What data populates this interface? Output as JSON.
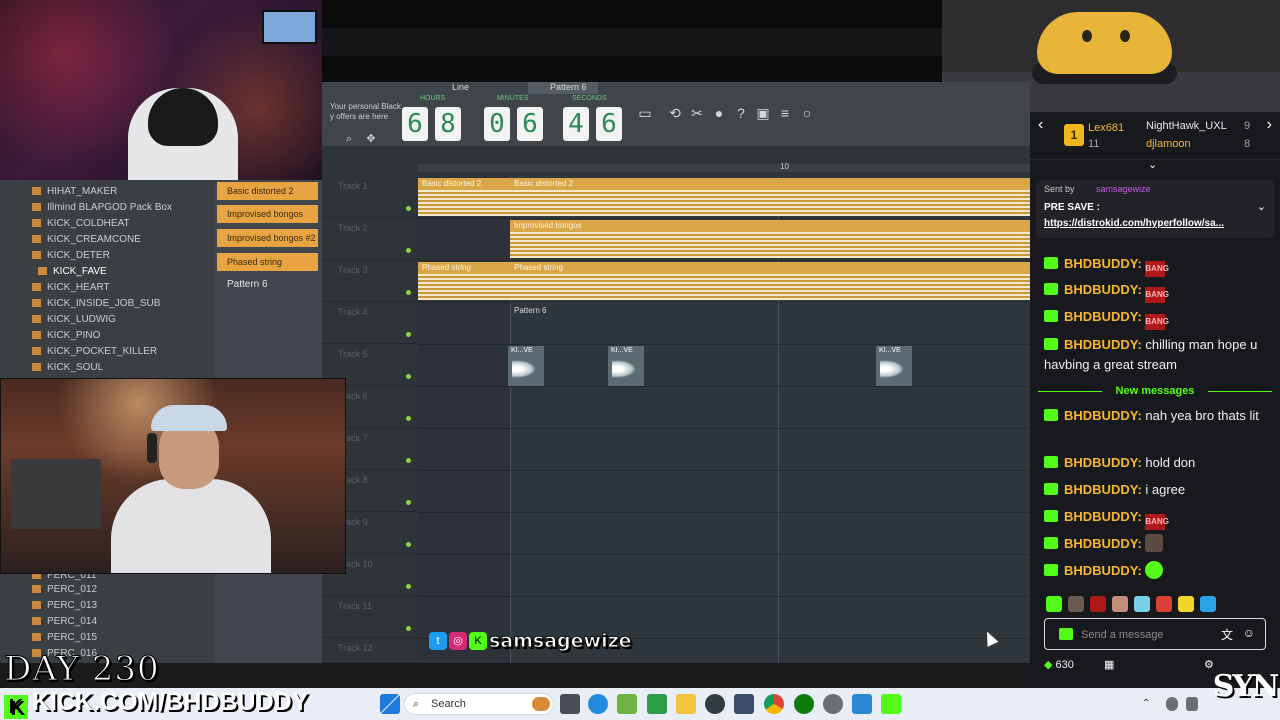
{
  "timer": {
    "digits": [
      "6",
      "8",
      "0",
      "6",
      "4",
      "6"
    ],
    "hours_label": "HOURS",
    "minutes_label": "MINUTES",
    "seconds_label": "SECONDS"
  },
  "daw": {
    "ad_line1": "Your personal Black",
    "ad_line2": "y offers are here",
    "mode": "Line",
    "pattern": "Pattern 6",
    "ruler_mark": "10",
    "tracks": [
      "Track 1",
      "Track 2",
      "Track 3",
      "Track 4",
      "Track 5",
      "Track 6",
      "Track 7",
      "Track 8",
      "Track 9",
      "Track 10",
      "Track 11",
      "Track 12"
    ],
    "clips": {
      "t1a": "Basic distorted 2",
      "t1b": "Basic distorted 2",
      "t2": "Improvised bongos",
      "t3a": "Phased string",
      "t3b": "Phased string",
      "t4": "Pattern 6",
      "kick": "KI...VE"
    }
  },
  "browser": {
    "items": [
      "HIHAT_MAKER",
      "Illmind BLAPGOD Pack Box",
      "KICK_COLDHEAT",
      "KICK_CREAMCONE",
      "KICK_DETER",
      "KICK_FAVE",
      "KICK_HEART",
      "KICK_INSIDE_JOB_SUB",
      "KICK_LUDWIG",
      "KICK_PINO",
      "KICK_POCKET_KILLER",
      "KICK_SOUL"
    ],
    "selected": "KICK_FAVE",
    "perc_items": [
      "PERC_011",
      "PERC_012",
      "PERC_013",
      "PERC_014",
      "PERC_015",
      "PERC_016"
    ]
  },
  "clip_list": [
    "Basic distorted 2",
    "Improvised bongos",
    "Improvised bongos #2",
    "Phased string"
  ],
  "pattern_item": "Pattern 6",
  "social_handle": "samsagewize",
  "overlay": {
    "day": "DAY 230",
    "kick_url": "KICK.COM/BHDBUDDY",
    "logo": "SYN"
  },
  "chat": {
    "top": {
      "rank": "1",
      "user1": "Lex681",
      "user1_count": "11",
      "user2": "NightHawk_UXL",
      "user2_count": "9",
      "user3": "djlamoon",
      "user3_count": "8"
    },
    "pinned": {
      "sent_by_label": "Sent by",
      "sent_by_user": "samsagewize",
      "title": "PRE SAVE :",
      "link": "https://distrokid.com/hyperfollow/sa..."
    },
    "user": "BHDBUDDY",
    "bang": "BANG",
    "messages": [
      {
        "text": ""
      },
      {
        "text": ""
      },
      {
        "text": ""
      },
      {
        "text": "chilling man hope u havbing a great stream"
      },
      {
        "text": "nah yea bro thats lit"
      },
      {
        "text": "hold don"
      },
      {
        "text": "i agree"
      },
      {
        "text": ""
      },
      {
        "text": ""
      },
      {
        "text": ""
      }
    ],
    "new_messages": "New messages",
    "input_placeholder": "Send a message",
    "points": "630"
  },
  "taskbar": {
    "search": "Search"
  },
  "colors": {
    "kick_green": "#53fc18",
    "clip_orange": "#e7a440",
    "username_gold": "#f6b62d"
  }
}
